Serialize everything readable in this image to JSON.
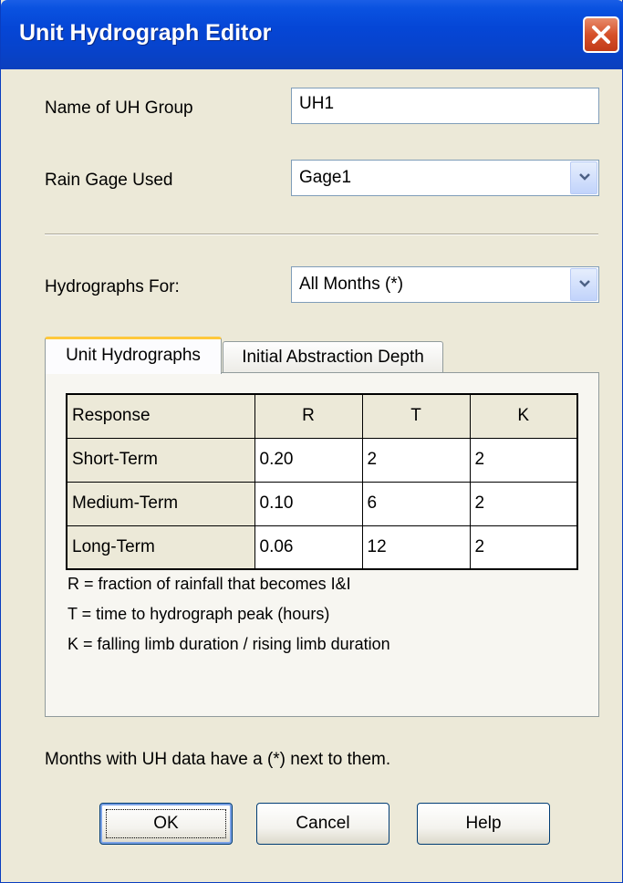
{
  "window": {
    "title": "Unit Hydrograph Editor"
  },
  "form": {
    "group_name_label": "Name of UH Group",
    "group_name_value": "UH1",
    "rain_gage_label": "Rain Gage Used",
    "rain_gage_value": "Gage1",
    "hydrographs_for_label": "Hydrographs For:",
    "hydrographs_for_value": "All Months (*)"
  },
  "tabs": [
    {
      "label": "Unit Hydrographs",
      "active": true
    },
    {
      "label": "Initial Abstraction Depth",
      "active": false
    }
  ],
  "table": {
    "columns": [
      "Response",
      "R",
      "T",
      "K"
    ],
    "rows": [
      {
        "label": "Short-Term",
        "r": "0.20",
        "t": "2",
        "k": "2"
      },
      {
        "label": "Medium-Term",
        "r": "0.10",
        "t": "6",
        "k": "2"
      },
      {
        "label": "Long-Term",
        "r": "0.06",
        "t": "12",
        "k": "2"
      }
    ]
  },
  "legend": [
    "R = fraction of rainfall that becomes I&I",
    "T = time to hydrograph peak (hours)",
    "K = falling limb duration / rising limb duration"
  ],
  "note": "Months with UH data have a (*) next to them.",
  "buttons": {
    "ok": "OK",
    "cancel": "Cancel",
    "help": "Help"
  },
  "colors": {
    "titlebar": "#0546d6",
    "dialog_bg": "#ece9d8",
    "close_button": "#d6512b",
    "active_tab_highlight": "#ffc83c"
  },
  "icons": {
    "close": "close-icon",
    "dropdown": "chevron-down-icon"
  }
}
